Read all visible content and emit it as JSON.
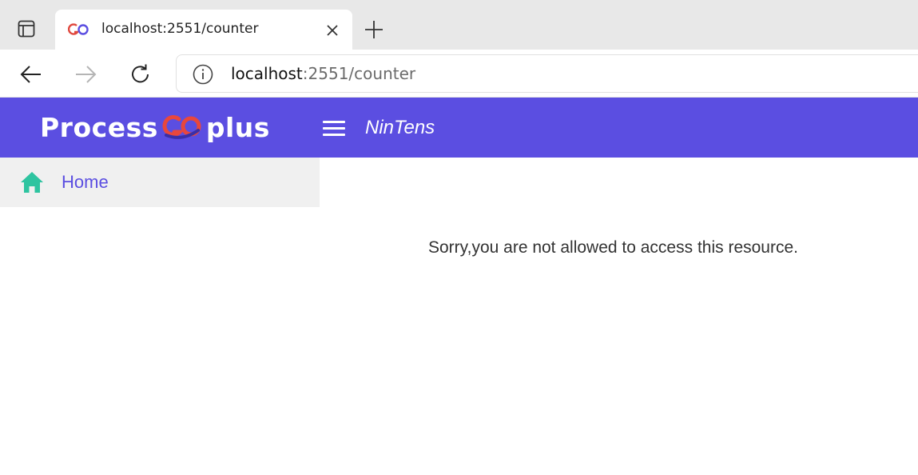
{
  "browser": {
    "tab": {
      "title": "localhost:2551/counter"
    },
    "address": {
      "host": "localhost",
      "rest": ":2551/counter"
    }
  },
  "header": {
    "logo": {
      "left": "Process",
      "right": "plus"
    },
    "org_name": "NinTens",
    "color": "#5b4ee1"
  },
  "sidebar": {
    "items": [
      {
        "label": "Home",
        "icon": "home-icon"
      }
    ]
  },
  "main": {
    "message": "Sorry,you are not allowed to access this resource."
  }
}
